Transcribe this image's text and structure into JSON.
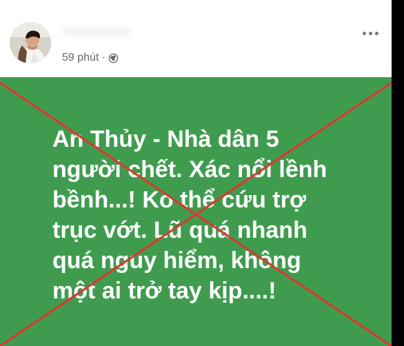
{
  "post": {
    "author_name": "",
    "time": "59 phút",
    "separator": "·",
    "privacy_icon": "globe-icon",
    "menu_icon": "more-horizontal-icon",
    "status_text": "An Thủy - Nhà dân 5\nngười chết. Xác nổi lềnh\nbềnh...! Ko thể cứu trợ\ntrục vớt. Lũ quá nhanh\nquá nguy hiểm, không\nmột ai trở tay kịp....!",
    "background_color": "#3f9c4f",
    "text_color": "#ffffff"
  },
  "overlay": {
    "type": "red-cross",
    "color": "#d93a2f"
  }
}
